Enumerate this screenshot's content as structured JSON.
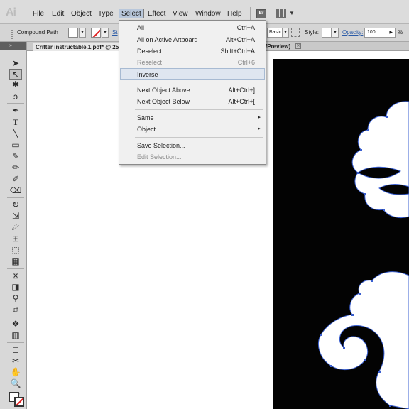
{
  "app": {
    "logo": "Ai"
  },
  "menubar": {
    "items": [
      "File",
      "Edit",
      "Object",
      "Type",
      "Select",
      "Effect",
      "View",
      "Window",
      "Help"
    ],
    "active": "Select",
    "bridge_label": "Br"
  },
  "controlbar": {
    "object_label": "Compound Path",
    "stroke_link": "St",
    "brush_value": "Basic",
    "style_label": "Style:",
    "opacity_link": "Opacity:",
    "opacity_value": "100",
    "opacity_unit": "%"
  },
  "document": {
    "tab_title": "Critter instructable.1.pdf* @ 25",
    "tab2_title": "/Preview)",
    "tab2_close": "✕"
  },
  "select_menu": {
    "items": [
      {
        "label": "All",
        "shortcut": "Ctrl+A",
        "disabled": false
      },
      {
        "label": "All on Active Artboard",
        "shortcut": "Alt+Ctrl+A",
        "disabled": false
      },
      {
        "label": "Deselect",
        "shortcut": "Shift+Ctrl+A",
        "disabled": false
      },
      {
        "label": "Reselect",
        "shortcut": "Ctrl+6",
        "disabled": true
      },
      {
        "label": "Inverse",
        "shortcut": "",
        "disabled": false,
        "highlighted": true
      },
      {
        "label": "Next Object Above",
        "shortcut": "Alt+Ctrl+]",
        "disabled": false
      },
      {
        "label": "Next Object Below",
        "shortcut": "Alt+Ctrl+[",
        "disabled": false
      },
      {
        "label": "Same",
        "shortcut": "",
        "submenu": true
      },
      {
        "label": "Object",
        "shortcut": "",
        "submenu": true
      },
      {
        "label": "Save Selection...",
        "shortcut": "",
        "disabled": false
      },
      {
        "label": "Edit Selection...",
        "shortcut": "",
        "disabled": true
      }
    ],
    "submenu_arrow": "▸"
  },
  "colors": {
    "menu_highlight": "#dfe6f0",
    "active_menu": "#b8c7db",
    "artboard_bg": "#030303",
    "shape_fill": "#ffffff",
    "anchor_color": "#3a5fd0"
  }
}
